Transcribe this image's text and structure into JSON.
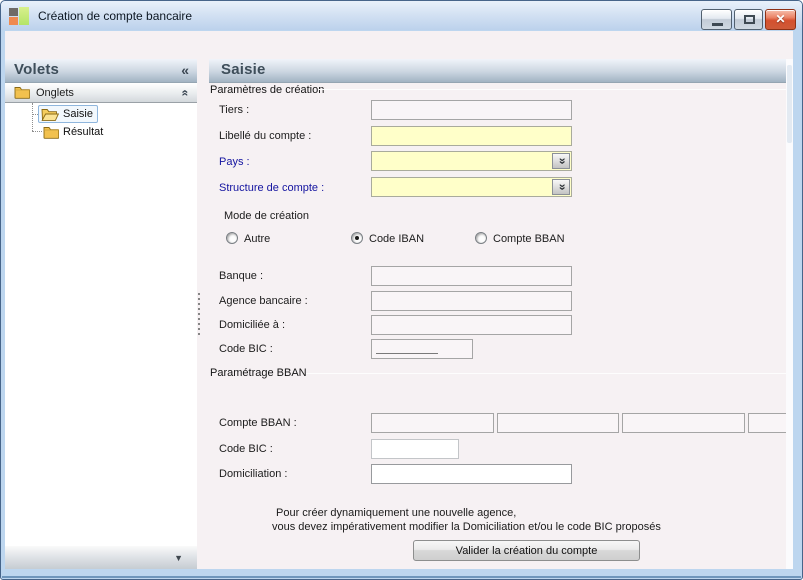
{
  "window": {
    "title": "Création de compte bancaire"
  },
  "glyphs": {
    "collapse_left": "«",
    "collapse_up": "«",
    "dropdown_down": "«",
    "scroll_down": "▼",
    "close": "✕"
  },
  "sidebar": {
    "title": "Volets",
    "section_label": "Onglets",
    "items": [
      {
        "label": "Saisie",
        "icon": "folder-open",
        "selected": true
      },
      {
        "label": "Résultat",
        "icon": "folder-closed",
        "selected": false
      }
    ]
  },
  "main": {
    "title": "Saisie",
    "creation_group": {
      "label": "Paramètres de création",
      "tiers_label": "Tiers :",
      "libelle_label": "Libellé du compte :",
      "pays_label": "Pays :",
      "structure_label": "Structure de compte :",
      "mode_label": "Mode de création",
      "mode_options": [
        {
          "label": "Autre",
          "selected": false
        },
        {
          "label": "Code IBAN",
          "selected": true
        },
        {
          "label": "Compte BBAN",
          "selected": false
        }
      ],
      "banque_label": "Banque :",
      "agence_label": "Agence bancaire :",
      "domiciliee_label": "Domiciliée à :",
      "codebic_label": "Code BIC :"
    },
    "bban_group": {
      "label": "Paramétrage BBAN",
      "comptebban_label": "Compte BBAN :",
      "codebic_label": "Code BIC :",
      "domiciliation_label": "Domiciliation :"
    },
    "note_line1": "Pour créer dynamiquement une nouvelle agence,",
    "note_line2": "vous devez impérativement modifier la Domiciliation et/ou le code BIC proposés",
    "submit_label": "Valider la création du compte"
  },
  "colors": {
    "required_field_bg": "#ffffc9",
    "required_label_text": "#1414a0",
    "header_text": "#3e4e5a",
    "content_bg": "#f6f1f3",
    "titlebar_gradient_top": "#e9f1fb",
    "close_button": "#d4502f"
  }
}
